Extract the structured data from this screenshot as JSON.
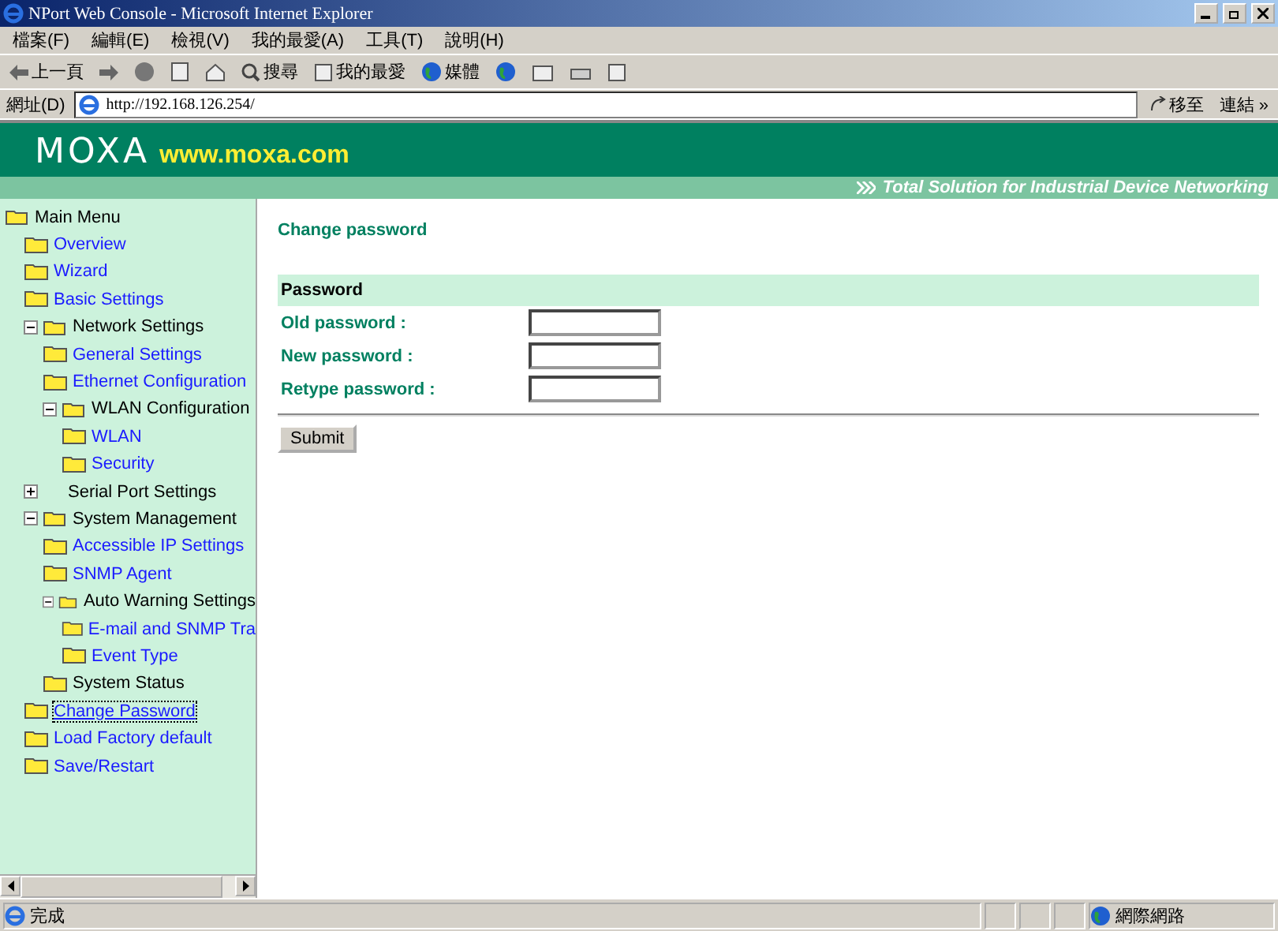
{
  "window": {
    "title": "NPort Web Console - Microsoft Internet Explorer"
  },
  "menu_bar": [
    "檔案(F)",
    "編輯(E)",
    "檢視(V)",
    "我的最愛(A)",
    "工具(T)",
    "說明(H)"
  ],
  "toolbar": {
    "back": "上一頁",
    "search": "搜尋",
    "favorites": "我的最愛",
    "media": "媒體"
  },
  "address_bar": {
    "label": "網址(D)",
    "value": "http://192.168.126.254/",
    "go": "移至",
    "links": "連結 »"
  },
  "banner": {
    "logo": "MOXA",
    "url": "www.moxa.com",
    "tagline": "Total Solution for Industrial Device Networking"
  },
  "sidebar": {
    "tree": [
      {
        "label": "Main Menu",
        "kind": "group",
        "expanded": true,
        "selected": false,
        "children": [
          {
            "label": "Overview",
            "kind": "link",
            "selected": false
          },
          {
            "label": "Wizard",
            "kind": "link",
            "selected": false
          },
          {
            "label": "Basic Settings",
            "kind": "link",
            "selected": false
          },
          {
            "label": "Network Settings",
            "kind": "group",
            "expanded": true,
            "selected": false,
            "children": [
              {
                "label": "General Settings",
                "kind": "link",
                "selected": false
              },
              {
                "label": "Ethernet Configuration",
                "kind": "link",
                "selected": false
              },
              {
                "label": "WLAN Configuration",
                "kind": "group",
                "expanded": true,
                "selected": false,
                "children": [
                  {
                    "label": "WLAN",
                    "kind": "link",
                    "selected": false
                  },
                  {
                    "label": "Security",
                    "kind": "link",
                    "selected": false
                  }
                ]
              }
            ]
          },
          {
            "label": "Serial Port Settings",
            "kind": "group",
            "expanded": false,
            "selected": false
          },
          {
            "label": "System Management",
            "kind": "group",
            "expanded": true,
            "selected": false,
            "children": [
              {
                "label": "Accessible IP Settings",
                "kind": "link",
                "selected": false
              },
              {
                "label": "SNMP Agent",
                "kind": "link",
                "selected": false
              },
              {
                "label": "Auto Warning Settings",
                "kind": "group",
                "expanded": true,
                "selected": false,
                "children": [
                  {
                    "label": "E-mail and SNMP Tra",
                    "kind": "link",
                    "selected": false
                  },
                  {
                    "label": "Event Type",
                    "kind": "link",
                    "selected": false
                  }
                ]
              },
              {
                "label": "System Status",
                "kind": "item",
                "selected": false
              }
            ]
          },
          {
            "label": "Change Password",
            "kind": "link",
            "selected": true
          },
          {
            "label": "Load Factory default",
            "kind": "link",
            "selected": false
          },
          {
            "label": "Save/Restart",
            "kind": "link",
            "selected": false
          }
        ]
      }
    ]
  },
  "content": {
    "title": "Change password",
    "section": "Password",
    "fields": [
      {
        "label": "Old password :"
      },
      {
        "label": "New password :"
      },
      {
        "label": "Retype password :"
      }
    ],
    "submit": "Submit"
  },
  "status_bar": {
    "text": "完成",
    "zone": "網際網路"
  }
}
